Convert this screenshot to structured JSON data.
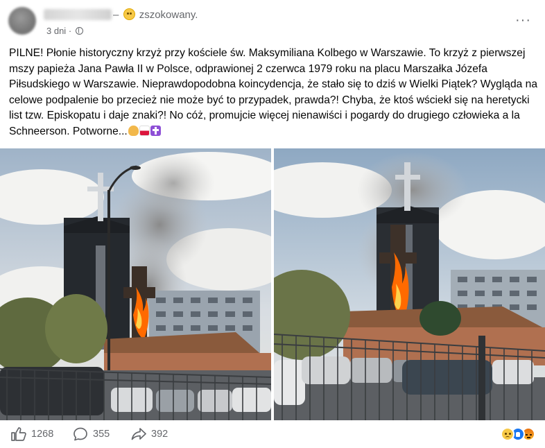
{
  "post": {
    "feeling_text": "– 😨 zszokowany.",
    "feeling_prefix": "–",
    "feeling_label": "zszokowany.",
    "time": "3 dni",
    "separator": "·",
    "privacy_icon": "globe-icon",
    "more_icon": "more-options-icon",
    "body": "PILNE! Płonie historyczny krzyż przy kościele św. Maksymiliana Kolbego w Warszawie. To krzyż z pierwszej mszy papieża Jana Pawła II w Polsce, odprawionej 2 czerwca 1979 roku na placu Marszałka Józefa Piłsudskiego w Warszawie. Nieprawdopodobna koincydencja, że stało się to dziś w Wielki Piątek? Wygląda na celowe podpalenie bo przecież nie może być to przypadek, prawda?! Chyba, że ktoś wściekł się na heretycki list tzw. Episkopatu i daje znaki?! No cóż, promujcie więcej nienawiści i pogardy do drugiego człowieka a la Schneerson. Potworne...",
    "tail_emojis": [
      "praying-hands-icon",
      "poland-flag-icon",
      "latin-cross-icon"
    ]
  },
  "photos": {
    "left_alt_icon": "burning-cross-photo-left",
    "right_alt_icon": "burning-cross-photo-right"
  },
  "stats": {
    "likes": "1268",
    "comments": "355",
    "shares": "392",
    "like_icon": "thumbs-up-icon",
    "comment_icon": "comment-bubble-icon",
    "share_icon": "share-arrow-icon"
  },
  "reactions": [
    "sad-reaction-icon",
    "like-reaction-icon",
    "angry-reaction-icon"
  ],
  "colors": {
    "secondary_text": "#65676b",
    "like_blue": "#1877f2",
    "sky": "#c9d6e3",
    "fire": "#ff6a00"
  }
}
